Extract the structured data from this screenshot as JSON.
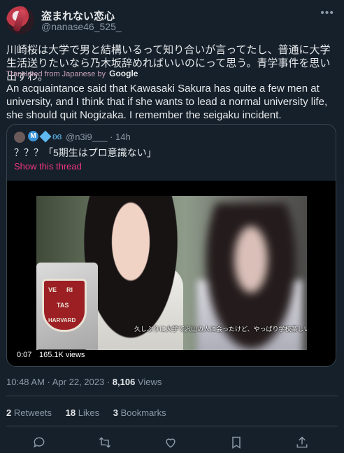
{
  "author": {
    "name": "盗まれない恋心",
    "handle": "@nanase46_525_"
  },
  "tweet": {
    "text_jp": "川崎桜は大学で男と結構いるって知り合いが言ってたし、普通に大学生活送りたいなら乃木坂辞めればいいのにって思う。青学事件を思い出すわ。",
    "translated_prefix": "Translated from Japanese by",
    "translated_provider": "Google",
    "text_en": "An acquaintance said that Kawasaki Sakura has quite a few men at university, and I think that if she wants to lead a normal university life, she should quit Nogizaka. I remember the seigaku incident."
  },
  "quote": {
    "badges": [
      "M",
      "diamond",
      "butterfly"
    ],
    "handle": "@n3i9___",
    "time": "· 14h",
    "text": "？？？「5期生はプロ意識ない」",
    "show_thread": "Show this thread",
    "video": {
      "subtitle": "久しぶりに大学で沢山の人に会ったけど、やっぱり学校楽しいな〜って思いました",
      "duration": "0:07",
      "views": "165.1K views",
      "shield_text": [
        "VE",
        "RI",
        "TAS",
        "HARVARD"
      ]
    }
  },
  "meta": {
    "time": "10:48 AM · Apr 22, 2023 · ",
    "views_count": "8,106",
    "views_label": " Views"
  },
  "stats": {
    "retweets_count": "2",
    "retweets_label": " Retweets",
    "likes_count": "18",
    "likes_label": " Likes",
    "bookmarks_count": "3",
    "bookmarks_label": " Bookmarks"
  },
  "icons": {
    "more": "more-icon",
    "reply": "reply-icon",
    "retweet": "retweet-icon",
    "like": "like-icon",
    "bookmark": "bookmark-icon",
    "share": "share-icon"
  },
  "colors": {
    "background": "#15202b",
    "text": "#e7e9ea",
    "secondary": "#8b98a5",
    "accent_pink": "#f0357c",
    "border": "#38444d"
  }
}
